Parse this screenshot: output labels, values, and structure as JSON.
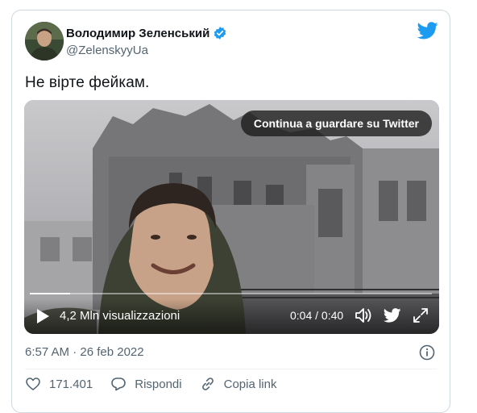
{
  "tweet": {
    "display_name": "Володимир Зеленський",
    "handle": "@ZelenskyyUa",
    "text": "Не вірте фейкам.",
    "timestamp": "6:57 AM · 26 feb 2022"
  },
  "video": {
    "continue_label": "Continua a guardare su Twitter",
    "views": "4,2 Mln visualizzazioni",
    "time": "0:04 / 0:40",
    "progress": 0.1
  },
  "actions": {
    "likes": "171.401",
    "reply_label": "Rispondi",
    "copy_link_label": "Copia link"
  },
  "icons": {
    "verified": "verified-badge-icon",
    "twitter": "twitter-bird-icon",
    "play": "play-icon",
    "volume": "volume-icon",
    "expand": "expand-icon",
    "info": "info-icon",
    "like": "heart-icon",
    "reply": "reply-icon",
    "link": "link-icon"
  },
  "colors": {
    "twitter_blue": "#1d9bf0",
    "text_primary": "#0f1419",
    "text_secondary": "#536471",
    "border": "#cfd9de"
  }
}
